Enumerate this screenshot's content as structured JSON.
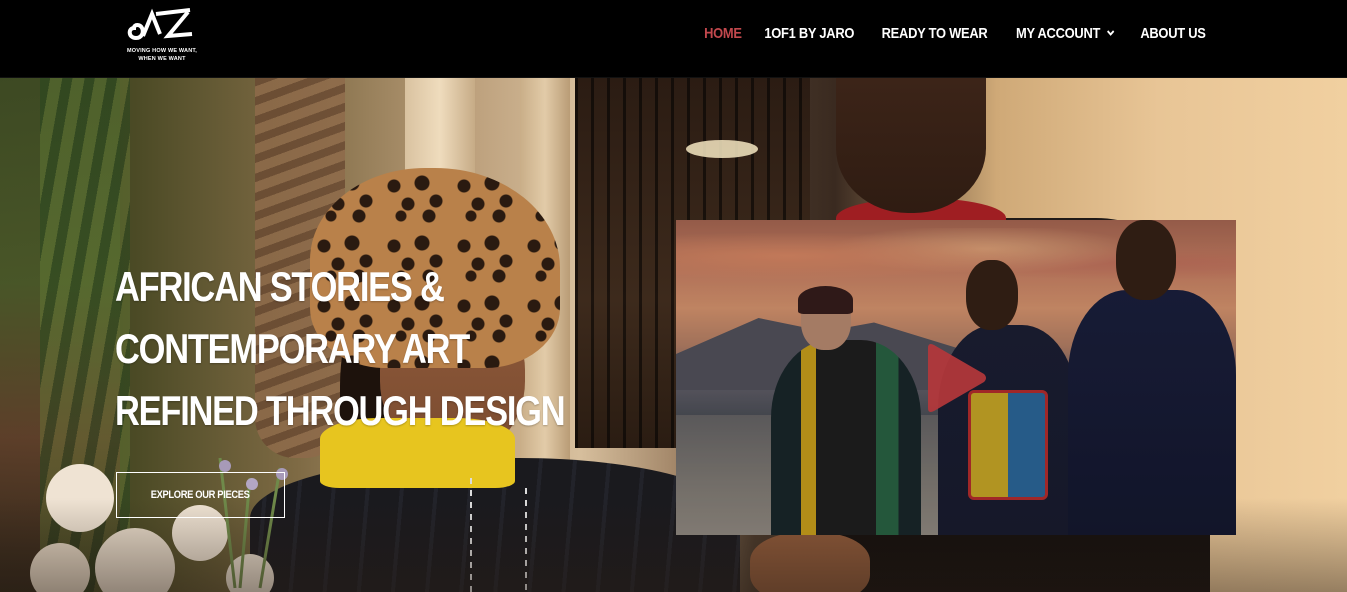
{
  "brand": {
    "tagline_line1": "MOVING HOW WE WANT,",
    "tagline_line2": "WHEN WE WANT"
  },
  "nav": {
    "items": [
      {
        "label": "HOME",
        "active": true
      },
      {
        "label": "1OF1 BY JARO",
        "active": false
      },
      {
        "label": "READY TO WEAR",
        "active": false
      },
      {
        "label": "MY ACCOUNT",
        "active": false,
        "has_dropdown": true
      },
      {
        "label": "ABOUT US",
        "active": false
      }
    ],
    "active_color": "#c2484d"
  },
  "hero": {
    "title_lines": [
      "AFRICAN STORIES &",
      "CONTEMPORARY ART",
      "REFINED THROUGH DESIGN"
    ],
    "cta_label": "EXPLORE OUR PIECES",
    "video": {
      "play_icon": "play-icon",
      "play_color": "#b5373b"
    }
  },
  "colors": {
    "header_bg": "#000000",
    "text": "#ffffff"
  }
}
